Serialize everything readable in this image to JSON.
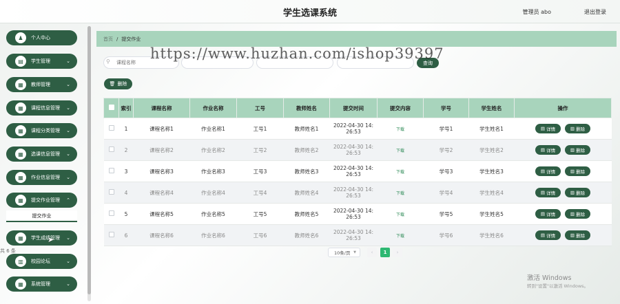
{
  "app": {
    "title": "学生选课系统",
    "user": "管理员 abo",
    "logout": "退出登录"
  },
  "sidebar": {
    "items": [
      {
        "label": "个人中心",
        "icon": "user-icon",
        "glyph": "♟"
      },
      {
        "label": "学生管理",
        "icon": "list-icon",
        "glyph": "▤"
      },
      {
        "label": "教师管理",
        "icon": "grid-icon",
        "glyph": "▦"
      },
      {
        "label": "课程信息管理",
        "icon": "grid-icon",
        "glyph": "▦"
      },
      {
        "label": "课程分类管理",
        "icon": "grid-icon",
        "glyph": "▦"
      },
      {
        "label": "选课信息管理",
        "icon": "grid-icon",
        "glyph": "▦"
      },
      {
        "label": "作业信息管理",
        "icon": "grid-icon",
        "glyph": "▦"
      },
      {
        "label": "提交作业管理",
        "icon": "grid-icon",
        "glyph": "▦"
      },
      {
        "label": "学生成绩管理",
        "icon": "grid-icon",
        "glyph": "▦"
      },
      {
        "label": "校园论坛",
        "icon": "bar-chart-icon",
        "glyph": "▥"
      },
      {
        "label": "系统管理",
        "icon": "grid-icon",
        "glyph": "▦"
      }
    ],
    "submenu_active": "提交作业"
  },
  "breadcrumb": {
    "home": "首页",
    "separator": "/",
    "current": "提交作业"
  },
  "search": {
    "course_placeholder": "课程名称",
    "query_label": "查询"
  },
  "toolbar": {
    "delete_label": "删除"
  },
  "watermark": "https://www.huzhan.com/ishop39397",
  "table": {
    "headers": [
      "索引",
      "课程名称",
      "作业名称",
      "工号",
      "教师姓名",
      "提交时间",
      "提交内容",
      "学号",
      "学生姓名",
      "操作"
    ],
    "rows": [
      {
        "index": "1",
        "course": "课程名称1",
        "homework": "作业名称1",
        "teacher_id": "工号1",
        "teacher": "教师姓名1",
        "time_date": "2022-04-30 14:",
        "time_clock": "26:53",
        "content": "下载",
        "student_id": "学号1",
        "student": "学生姓名1"
      },
      {
        "index": "2",
        "course": "课程名称2",
        "homework": "作业名称2",
        "teacher_id": "工号2",
        "teacher": "教师姓名2",
        "time_date": "2022-04-30 14:",
        "time_clock": "26:53",
        "content": "下载",
        "student_id": "学号2",
        "student": "学生姓名2"
      },
      {
        "index": "3",
        "course": "课程名称3",
        "homework": "作业名称3",
        "teacher_id": "工号3",
        "teacher": "教师姓名3",
        "time_date": "2022-04-30 14:",
        "time_clock": "26:53",
        "content": "下载",
        "student_id": "学号3",
        "student": "学生姓名3"
      },
      {
        "index": "4",
        "course": "课程名称4",
        "homework": "作业名称4",
        "teacher_id": "工号4",
        "teacher": "教师姓名4",
        "time_date": "2022-04-30 14:",
        "time_clock": "26:53",
        "content": "下载",
        "student_id": "学号4",
        "student": "学生姓名4"
      },
      {
        "index": "5",
        "course": "课程名称5",
        "homework": "作业名称5",
        "teacher_id": "工号5",
        "teacher": "教师姓名5",
        "time_date": "2022-04-30 14:",
        "time_clock": "26:53",
        "content": "下载",
        "student_id": "学号5",
        "student": "学生姓名5"
      },
      {
        "index": "6",
        "course": "课程名称6",
        "homework": "作业名称6",
        "teacher_id": "工号6",
        "teacher": "教师姓名6",
        "time_date": "2022-04-30 14:",
        "time_clock": "26:53",
        "content": "下载",
        "student_id": "学号6",
        "student": "学生姓名6"
      }
    ],
    "actions": {
      "detail": "详情",
      "delete": "删除"
    }
  },
  "pagination": {
    "total": "共 6 条",
    "page_size": "10条/页",
    "prev": "‹",
    "next": "›",
    "current_page": "1"
  },
  "windows": {
    "activate_title": "激活 Windows",
    "activate_hint": "转到\"设置\"以激活 Windows。"
  },
  "colors": {
    "primary": "#2e5e44",
    "header_bg": "#a8d4bc",
    "page_active": "#2eb872"
  }
}
